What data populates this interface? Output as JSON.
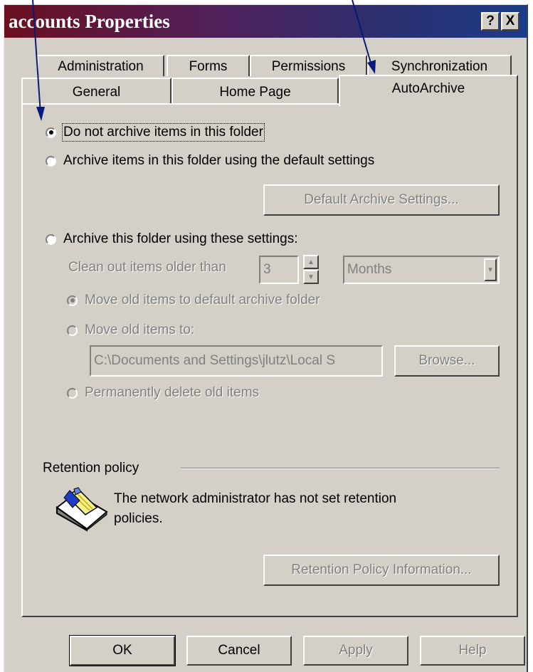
{
  "window": {
    "title": "accounts Properties",
    "help_button": "?",
    "close_button": "X"
  },
  "tabs": {
    "row1": [
      "Administration",
      "Forms",
      "Permissions",
      "Synchronization"
    ],
    "row2": [
      "General",
      "Home Page",
      "AutoArchive"
    ],
    "active": "AutoArchive"
  },
  "archive": {
    "option_no_archive": "Do not archive items in this folder",
    "option_default": "Archive items in this folder using the default settings",
    "default_settings_button": "Default Archive Settings...",
    "option_custom": "Archive this folder using these settings:",
    "clean_out_label": "Clean out items older than",
    "clean_out_value": "3",
    "period_value": "Months",
    "move_default": "Move old items to default archive folder",
    "move_to": "Move old items to:",
    "path_value": "C:\\Documents and Settings\\jlutz\\Local S",
    "browse_button": "Browse...",
    "permanently_delete": "Permanently delete old items",
    "selected": "Do not archive items in this folder"
  },
  "retention": {
    "heading": "Retention policy",
    "message_line1": "The network administrator has not set retention",
    "message_line2": "policies.",
    "info_button": "Retention Policy Information..."
  },
  "footer": {
    "ok": "OK",
    "cancel": "Cancel",
    "apply": "Apply",
    "help": "Help"
  },
  "colors": {
    "dialog_bg": "#d4d0c8",
    "arrow": "#0a1a78"
  }
}
